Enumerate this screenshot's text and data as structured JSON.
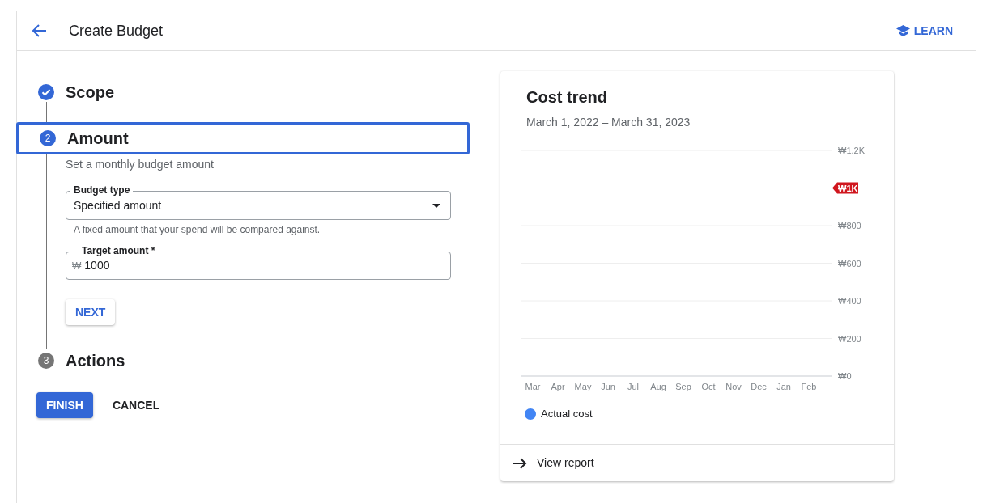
{
  "header": {
    "title": "Create Budget",
    "learn_label": "LEARN"
  },
  "steps": [
    {
      "title": "Scope",
      "completed": true,
      "selected": false
    },
    {
      "number": "2",
      "title": "Amount",
      "completed": false,
      "selected": true,
      "subtitle": "Set a monthly budget amount",
      "fields": [
        {
          "kind": "select",
          "label": "Budget type",
          "value": "Specified amount",
          "hint": "A fixed amount that your spend will be compared against."
        },
        {
          "kind": "input",
          "label": "Target amount *",
          "prefix": "₩",
          "value": "1000"
        }
      ],
      "next_label": "NEXT"
    },
    {
      "number": "3",
      "title": "Actions",
      "completed": false,
      "selected": false
    }
  ],
  "actions": {
    "finish": "FINISH",
    "cancel": "CANCEL"
  },
  "cost_card": {
    "title": "Cost trend",
    "date_range": "March 1, 2022 – March 31, 2023",
    "chart_data": {
      "type": "line",
      "categories": [
        "Mar",
        "Apr",
        "May",
        "Jun",
        "Jul",
        "Aug",
        "Sep",
        "Oct",
        "Nov",
        "Dec",
        "Jan",
        "Feb"
      ],
      "series": [
        {
          "name": "Actual cost",
          "color": "#4285f4",
          "values": [
            null,
            null,
            null,
            null,
            null,
            null,
            null,
            null,
            null,
            null,
            null,
            null
          ]
        }
      ],
      "ylim": [
        0,
        1200
      ],
      "yticks": [
        {
          "value": 0,
          "label": "₩0"
        },
        {
          "value": 200,
          "label": "₩200"
        },
        {
          "value": 400,
          "label": "₩400"
        },
        {
          "value": 600,
          "label": "₩600"
        },
        {
          "value": 800,
          "label": "₩800"
        },
        {
          "value": 1200,
          "label": "₩1.2K"
        }
      ],
      "grid": true,
      "ref_lines": [
        {
          "axis": "y",
          "value": 1000,
          "label": "₩1K"
        }
      ]
    },
    "link_label": "View report"
  }
}
